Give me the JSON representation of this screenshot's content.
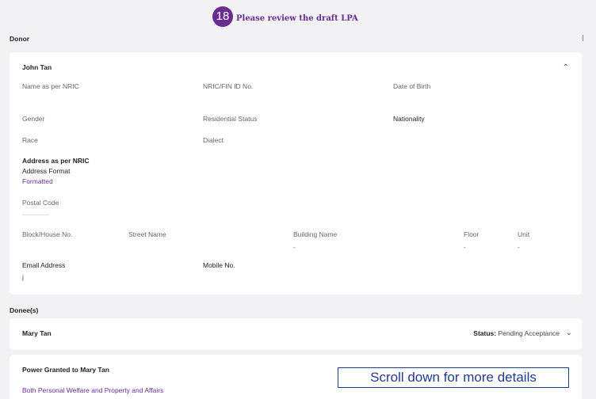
{
  "step": {
    "number": "18",
    "title": "Please review the draft LPA"
  },
  "donor": {
    "section_label": "Donor",
    "name": "John Tan",
    "fields": {
      "name_nric": "Name as per NRIC",
      "nric_id": "NRIC/FIN ID No.",
      "dob": "Date of Birth",
      "gender": "Gender",
      "residential_status": "Residential Status",
      "nationality": "Nationality",
      "race": "Race",
      "dialect": "Dialect",
      "address_nric": "Address as per NRIC",
      "address_format": "Address Format",
      "address_format_value": "Formatted",
      "postal_code": "Postal Code",
      "block": "Block/House No.",
      "street": "Street Name",
      "building": "Building Name",
      "building_value": "-",
      "floor": "Floor",
      "floor_value": "-",
      "unit": "Unit",
      "unit_value": "-",
      "email": "Email Address",
      "email_value": "j",
      "mobile": "Mobile No."
    }
  },
  "donees": {
    "section_label": "Donee(s)",
    "name": "Mary Tan",
    "status_label": "Status:",
    "status_value": "Pending Acceptance"
  },
  "power": {
    "title": "Power Granted to Mary Tan",
    "value": "Both Personal Welfare and Property and Affairs"
  },
  "scroll_hint": "Scroll down for more details"
}
